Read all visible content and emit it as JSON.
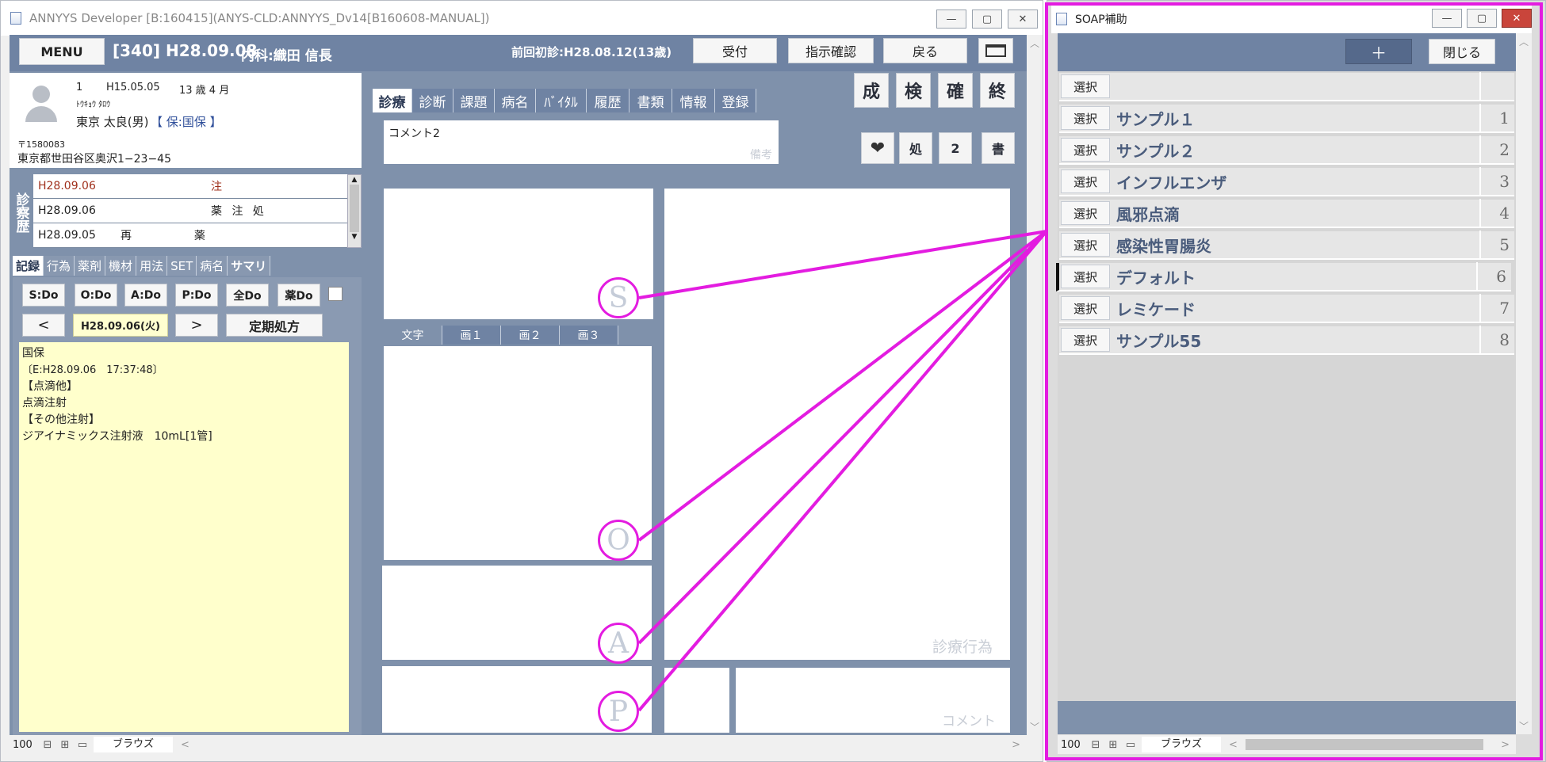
{
  "main_window": {
    "title": "ANNYYS Developer [B:160415](ANYS-CLD:ANNYYS_Dv14[B160608-MANUAL])",
    "header": {
      "menu_label": "MENU",
      "visit_info": "[340] H28.09.08",
      "dept_doctor": "内科:織田 信長",
      "prev_visit": "前回初診:H28.08.12(13歳)",
      "buttons": [
        "受付",
        "指示確認",
        "戻る"
      ]
    },
    "patient": {
      "id": "1",
      "birth": "H15.05.05",
      "age": "13 歳 4 月",
      "kana": "ﾄｳｷｮｳ ﾀﾛｳ",
      "name": "東京 太良(男)",
      "insurance": "【 保:国保 】",
      "postal": "〒1580083",
      "address": "東京都世田谷区奥沢1−23−45"
    },
    "history_label": "診察歴",
    "history_rows": [
      {
        "date": "H28.09.06",
        "tags": "注"
      },
      {
        "date": "H28.09.06",
        "tags": "薬 注 処"
      },
      {
        "date": "H28.09.05",
        "tags": "再 　 薬"
      }
    ],
    "left_tabs": [
      "記録",
      "行為",
      "薬剤",
      "機材",
      "用法",
      "SET",
      "病名",
      "サマリ"
    ],
    "do_buttons": [
      "S:Do",
      "O:Do",
      "A:Do",
      "P:Do",
      "全Do",
      "薬Do"
    ],
    "date_nav": {
      "prev": "<",
      "date": "H28.09.06(火)",
      "next": ">",
      "regular": "定期処方"
    },
    "record_lines": [
      "国保",
      "〔E:H28.09.06　17:37:48〕",
      "【点滴他】",
      "点滴注射",
      "【その他注射】",
      "ジアイナミックス注射液　10mL[1管]"
    ],
    "center_tabs": [
      "診療",
      "診断",
      "課題",
      "病名",
      "ﾊﾞｲﾀﾙ",
      "履歴",
      "書類",
      "情報",
      "登録"
    ],
    "right_square_buttons": [
      "成",
      "検",
      "確",
      "終"
    ],
    "comment_text": "コメント2",
    "comment_hint": "備考",
    "small_buttons": [
      "処",
      "2",
      "書"
    ],
    "sub_tabs": [
      "文字",
      "画１",
      "画２",
      "画３"
    ],
    "watermarks": {
      "actions": "診療行為",
      "comment": "コメント"
    },
    "soap_circles": [
      "S",
      "O",
      "A",
      "P"
    ],
    "status": {
      "zoom": "100",
      "browse": "ブラウズ"
    }
  },
  "soap_window": {
    "title": "SOAP補助",
    "add_label": "＋",
    "close_label": "閉じる",
    "select_label": "選択",
    "rows": [
      {
        "name": "",
        "num": ""
      },
      {
        "name": "サンプル１",
        "num": "1"
      },
      {
        "name": "サンプル２",
        "num": "2"
      },
      {
        "name": "インフルエンザ",
        "num": "3"
      },
      {
        "name": "風邪点滴",
        "num": "4"
      },
      {
        "name": "感染性胃腸炎",
        "num": "5"
      },
      {
        "name": "デフォルト",
        "num": "6"
      },
      {
        "name": "レミケード",
        "num": "7"
      },
      {
        "name": "サンプル55",
        "num": "8"
      }
    ],
    "status": {
      "zoom": "100",
      "browse": "ブラウズ"
    }
  },
  "colors": {
    "header_bg": "#6f83a3",
    "annotation": "#e31ce0",
    "record_bg": "#ffffcc"
  }
}
